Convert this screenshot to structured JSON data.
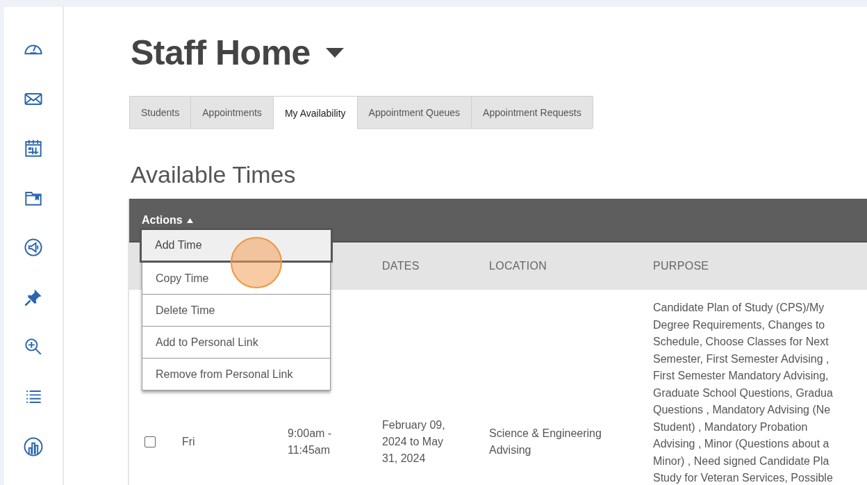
{
  "page": {
    "title": "Staff Home"
  },
  "tabs": [
    {
      "label": "Students",
      "selected": false
    },
    {
      "label": "Appointments",
      "selected": false
    },
    {
      "label": "My Availability",
      "selected": true
    },
    {
      "label": "Appointment Queues",
      "selected": false
    },
    {
      "label": "Appointment Requests",
      "selected": false
    }
  ],
  "section_title": "Available Times",
  "actions": {
    "label": "Actions",
    "expanded": true,
    "items": [
      {
        "label": "Add Time",
        "selected": true
      },
      {
        "label": "Copy Time",
        "selected": false
      },
      {
        "label": "Delete Time",
        "selected": false
      },
      {
        "label": "Add to Personal Link",
        "selected": false
      },
      {
        "label": "Remove from Personal Link",
        "selected": false
      }
    ]
  },
  "table": {
    "columns": [
      "DATES",
      "LOCATION",
      "PURPOSE"
    ],
    "rows": [
      {
        "checked": false,
        "day": "Fri",
        "time": "9:00am -\n11:45am",
        "dates": "February 09,\n2024 to May\n31, 2024",
        "location": "Science & Engineering\nAdvising",
        "purpose": "Candidate Plan of Study (CPS)/My\nDegree Requirements, Changes to\nSchedule, Choose Classes for Next\nSemester, First Semester Advising ,\nFirst Semester Mandatory Advising,\nGraduate School Questions, Gradua\nQuestions , Mandatory Advising (Ne\nStudent) , Mandatory Probation\nAdvising , Minor (Questions about a\nMinor) , Need signed Candidate Pla\nStudy for Veteran Services, Possible"
      }
    ]
  },
  "click_marker": {
    "kind": "circle"
  }
}
